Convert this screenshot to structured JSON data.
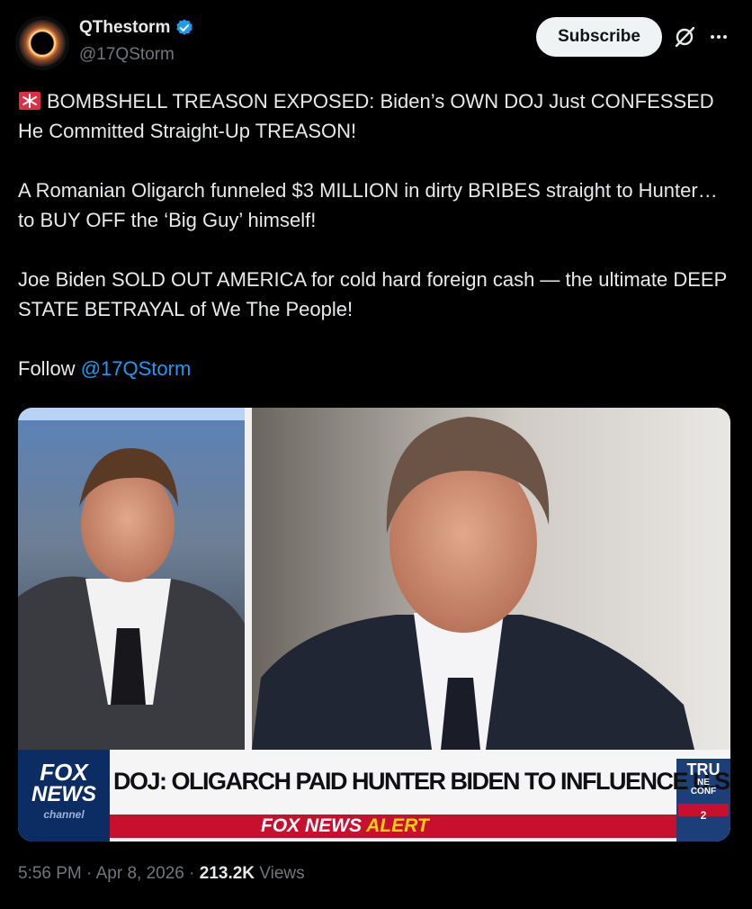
{
  "account": {
    "display_name": "QThestorm",
    "handle": "@17QStorm",
    "verified": true
  },
  "actions": {
    "subscribe_label": "Subscribe"
  },
  "tweet": {
    "line1": "BOMBSHELL TREASON EXPOSED: Biden’s OWN DOJ Just CONFESSED He Committed Straight-Up TREASON!",
    "para2": "A Romanian Oligarch funneled $3 MILLION in dirty BRIBES straight to Hunter… to BUY OFF the ‘Big Guy’ himself!",
    "para3": "Joe Biden SOLD OUT AMERICA for cold hard foreign cash — the ultimate DEEP STATE BETRAYAL of We The People!",
    "follow_prefix": "Follow ",
    "follow_mention": "@17QStorm"
  },
  "media": {
    "network_logo_line1": "FOX",
    "network_logo_line2": "NEWS",
    "network_logo_line3": "channel",
    "chyron_headline": "DOJ: OLIGARCH PAID HUNTER BIDEN TO INFLUENCE U.S.",
    "alert_brand": "FOX NEWS",
    "alert_word": "ALERT",
    "side_box_line1": "TRU",
    "side_box_line2": "NE",
    "side_box_line3": "CONF",
    "side_box_line4": "2"
  },
  "meta": {
    "time": "5:56 PM",
    "separator": " · ",
    "date": "Apr 8, 2026",
    "views_count": "213.2K",
    "views_label": " Views"
  },
  "colors": {
    "background": "#000000",
    "text": "#e7e9ea",
    "muted": "#71767b",
    "link": "#1d9bf0",
    "verified_badge": "#1d9bf0",
    "alert_red": "#c8102e",
    "alert_yellow": "#ffd200"
  },
  "icons": [
    "storm-eye-avatar",
    "verified-badge-icon",
    "grok-slash-icon",
    "more-dots-icon",
    "siren-emoji-icon"
  ]
}
